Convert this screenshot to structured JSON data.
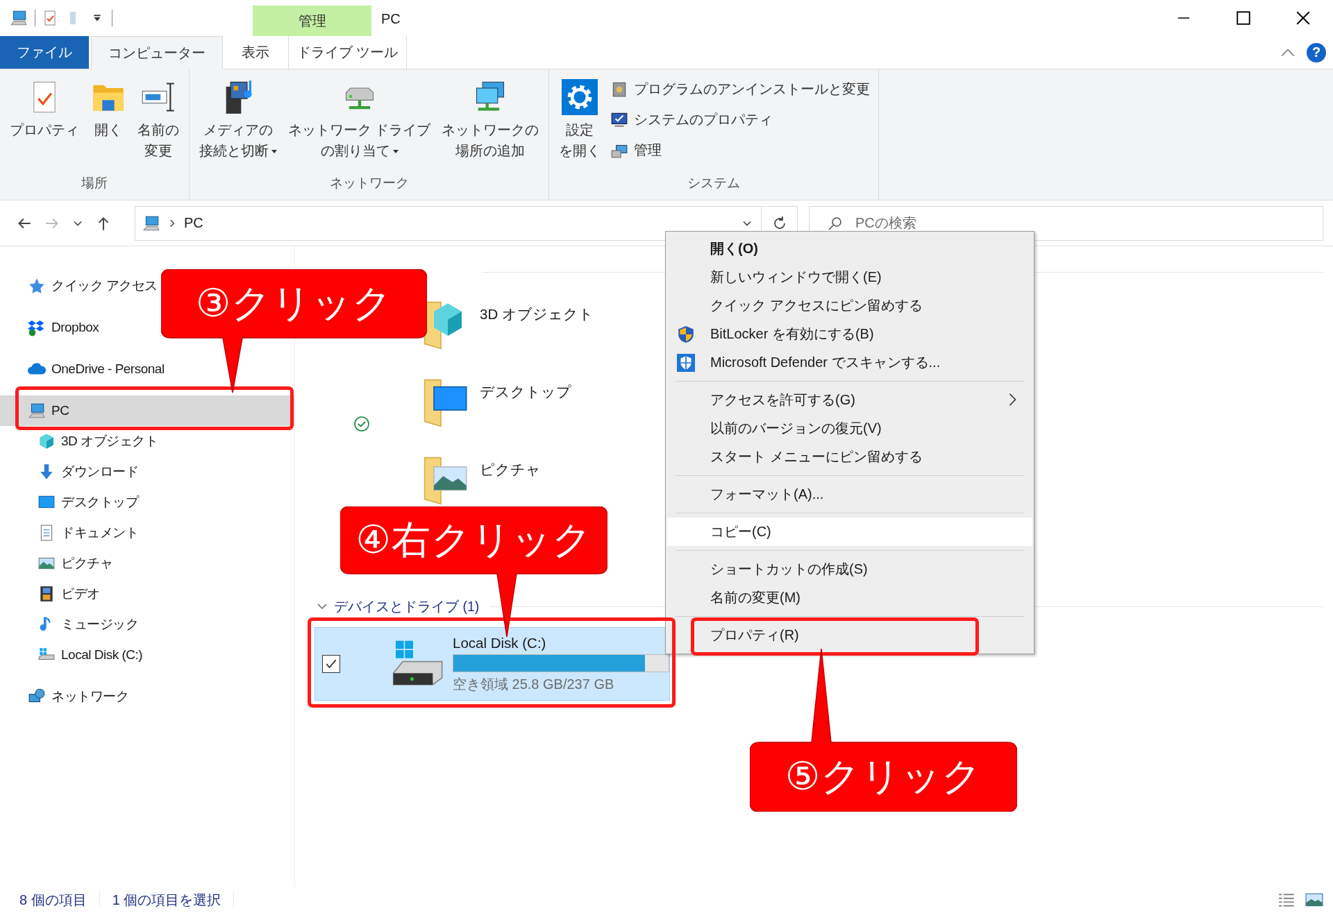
{
  "title_bar": {
    "context_tab": "管理",
    "title": "PC"
  },
  "ribbon_tabs": [
    {
      "label": "ファイル",
      "kind": "file",
      "selected": false
    },
    {
      "label": "コンピューター",
      "kind": "tab",
      "selected": true
    },
    {
      "label": "表示",
      "kind": "tab",
      "selected": false
    },
    {
      "label": "ドライブ ツール",
      "kind": "tab",
      "selected": false
    }
  ],
  "help_label": "?",
  "ribbon_groups": [
    {
      "label": "場所",
      "buttons": [
        {
          "lines": [
            "プロパティ"
          ],
          "kind": "large",
          "dropdown": false
        },
        {
          "lines": [
            "開く"
          ],
          "kind": "large",
          "dropdown": false
        },
        {
          "lines": [
            "名前の",
            "変更"
          ],
          "kind": "large",
          "dropdown": false
        }
      ]
    },
    {
      "label": "ネットワーク",
      "buttons": [
        {
          "lines": [
            "メディアの",
            "接続と切断"
          ],
          "kind": "large",
          "dropdown": true
        },
        {
          "lines": [
            "ネットワーク ドライブ",
            "の割り当て"
          ],
          "kind": "large",
          "dropdown": true
        },
        {
          "lines": [
            "ネットワークの",
            "場所の追加"
          ],
          "kind": "large",
          "dropdown": false
        }
      ]
    },
    {
      "label": "システム",
      "buttons": [
        {
          "lines": [
            "設定",
            "を開く"
          ],
          "kind": "large",
          "dropdown": false
        },
        {
          "lines": [
            "プログラムのアンインストールと変更"
          ],
          "kind": "small",
          "dropdown": false
        },
        {
          "lines": [
            "システムのプロパティ"
          ],
          "kind": "small",
          "dropdown": false
        },
        {
          "lines": [
            "管理"
          ],
          "kind": "small",
          "dropdown": false
        }
      ]
    }
  ],
  "address_bar": {
    "location": "PC"
  },
  "search": {
    "placeholder": "PCの検索"
  },
  "nav": [
    {
      "label": "クイック アクセス",
      "selected": false
    },
    {
      "label": "Dropbox",
      "selected": false
    },
    {
      "label": "OneDrive - Personal",
      "selected": false
    },
    {
      "label": "PC",
      "selected": true,
      "children": [
        {
          "label": "3D オブジェクト",
          "selected": false
        },
        {
          "label": "ダウンロード",
          "selected": false
        },
        {
          "label": "デスクトップ",
          "selected": false
        },
        {
          "label": "ドキュメント",
          "selected": false
        },
        {
          "label": "ピクチャ",
          "selected": false
        },
        {
          "label": "ビデオ",
          "selected": false
        },
        {
          "label": "ミュージック",
          "selected": false
        },
        {
          "label": "Local Disk (C:)",
          "selected": false
        }
      ]
    },
    {
      "label": "ネットワーク",
      "selected": false
    }
  ],
  "folders": [
    {
      "name": "3D オブジェクト",
      "synced": false
    },
    {
      "name": "デスクトップ",
      "synced": true
    },
    {
      "name": "ピクチャ",
      "synced": false
    }
  ],
  "drives_section": {
    "label": "デバイスとドライブ (1)",
    "expanded": true
  },
  "drive": {
    "name": "Local Disk (C:)",
    "free_space": "空き領域 25.8 GB/237 GB",
    "level": 0.89,
    "selected": true,
    "checked": true
  },
  "context_menu": {
    "groups": [
      [
        {
          "label": "開く(O)",
          "bold": true,
          "submenu": false,
          "highlighted": false
        },
        {
          "label": "新しいウィンドウで開く(E)",
          "bold": false,
          "submenu": false,
          "highlighted": false
        },
        {
          "label": "クイック アクセスにピン留めする",
          "bold": false,
          "submenu": false,
          "highlighted": false
        },
        {
          "label": "BitLocker を有効にする(B)",
          "bold": false,
          "submenu": false,
          "highlighted": false
        },
        {
          "label": "Microsoft Defender でスキャンする...",
          "bold": false,
          "submenu": false,
          "highlighted": false
        }
      ],
      [
        {
          "label": "アクセスを許可する(G)",
          "bold": false,
          "submenu": true,
          "highlighted": false
        },
        {
          "label": "以前のバージョンの復元(V)",
          "bold": false,
          "submenu": false,
          "highlighted": false
        },
        {
          "label": "スタート メニューにピン留めする",
          "bold": false,
          "submenu": false,
          "highlighted": false
        }
      ],
      [
        {
          "label": "フォーマット(A)...",
          "bold": false,
          "submenu": false,
          "highlighted": false
        }
      ],
      [
        {
          "label": "コピー(C)",
          "bold": false,
          "submenu": false,
          "highlighted": true
        }
      ],
      [
        {
          "label": "ショートカットの作成(S)",
          "bold": false,
          "submenu": false,
          "highlighted": false
        },
        {
          "label": "名前の変更(M)",
          "bold": false,
          "submenu": false,
          "highlighted": false
        }
      ],
      [
        {
          "label": "プロパティ(R)",
          "bold": false,
          "submenu": false,
          "highlighted": false
        }
      ]
    ]
  },
  "callouts": [
    {
      "text": "③クリック"
    },
    {
      "text": "④右クリック"
    },
    {
      "text": "⑤クリック"
    }
  ],
  "status_bar": {
    "item_count": "8 個の項目",
    "selection": "1 個の項目を選択"
  }
}
